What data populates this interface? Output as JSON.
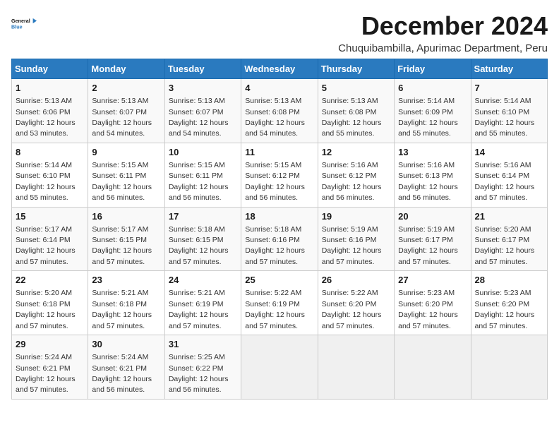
{
  "logo": {
    "line1": "General",
    "line2": "Blue"
  },
  "header": {
    "month_year": "December 2024",
    "location": "Chuquibambilla, Apurimac Department, Peru"
  },
  "weekdays": [
    "Sunday",
    "Monday",
    "Tuesday",
    "Wednesday",
    "Thursday",
    "Friday",
    "Saturday"
  ],
  "weeks": [
    [
      {
        "day": "1",
        "sunrise": "5:13 AM",
        "sunset": "6:06 PM",
        "daylight": "12 hours and 53 minutes."
      },
      {
        "day": "2",
        "sunrise": "5:13 AM",
        "sunset": "6:07 PM",
        "daylight": "12 hours and 54 minutes."
      },
      {
        "day": "3",
        "sunrise": "5:13 AM",
        "sunset": "6:07 PM",
        "daylight": "12 hours and 54 minutes."
      },
      {
        "day": "4",
        "sunrise": "5:13 AM",
        "sunset": "6:08 PM",
        "daylight": "12 hours and 54 minutes."
      },
      {
        "day": "5",
        "sunrise": "5:13 AM",
        "sunset": "6:08 PM",
        "daylight": "12 hours and 55 minutes."
      },
      {
        "day": "6",
        "sunrise": "5:14 AM",
        "sunset": "6:09 PM",
        "daylight": "12 hours and 55 minutes."
      },
      {
        "day": "7",
        "sunrise": "5:14 AM",
        "sunset": "6:10 PM",
        "daylight": "12 hours and 55 minutes."
      }
    ],
    [
      {
        "day": "8",
        "sunrise": "5:14 AM",
        "sunset": "6:10 PM",
        "daylight": "12 hours and 55 minutes."
      },
      {
        "day": "9",
        "sunrise": "5:15 AM",
        "sunset": "6:11 PM",
        "daylight": "12 hours and 56 minutes."
      },
      {
        "day": "10",
        "sunrise": "5:15 AM",
        "sunset": "6:11 PM",
        "daylight": "12 hours and 56 minutes."
      },
      {
        "day": "11",
        "sunrise": "5:15 AM",
        "sunset": "6:12 PM",
        "daylight": "12 hours and 56 minutes."
      },
      {
        "day": "12",
        "sunrise": "5:16 AM",
        "sunset": "6:12 PM",
        "daylight": "12 hours and 56 minutes."
      },
      {
        "day": "13",
        "sunrise": "5:16 AM",
        "sunset": "6:13 PM",
        "daylight": "12 hours and 56 minutes."
      },
      {
        "day": "14",
        "sunrise": "5:16 AM",
        "sunset": "6:14 PM",
        "daylight": "12 hours and 57 minutes."
      }
    ],
    [
      {
        "day": "15",
        "sunrise": "5:17 AM",
        "sunset": "6:14 PM",
        "daylight": "12 hours and 57 minutes."
      },
      {
        "day": "16",
        "sunrise": "5:17 AM",
        "sunset": "6:15 PM",
        "daylight": "12 hours and 57 minutes."
      },
      {
        "day": "17",
        "sunrise": "5:18 AM",
        "sunset": "6:15 PM",
        "daylight": "12 hours and 57 minutes."
      },
      {
        "day": "18",
        "sunrise": "5:18 AM",
        "sunset": "6:16 PM",
        "daylight": "12 hours and 57 minutes."
      },
      {
        "day": "19",
        "sunrise": "5:19 AM",
        "sunset": "6:16 PM",
        "daylight": "12 hours and 57 minutes."
      },
      {
        "day": "20",
        "sunrise": "5:19 AM",
        "sunset": "6:17 PM",
        "daylight": "12 hours and 57 minutes."
      },
      {
        "day": "21",
        "sunrise": "5:20 AM",
        "sunset": "6:17 PM",
        "daylight": "12 hours and 57 minutes."
      }
    ],
    [
      {
        "day": "22",
        "sunrise": "5:20 AM",
        "sunset": "6:18 PM",
        "daylight": "12 hours and 57 minutes."
      },
      {
        "day": "23",
        "sunrise": "5:21 AM",
        "sunset": "6:18 PM",
        "daylight": "12 hours and 57 minutes."
      },
      {
        "day": "24",
        "sunrise": "5:21 AM",
        "sunset": "6:19 PM",
        "daylight": "12 hours and 57 minutes."
      },
      {
        "day": "25",
        "sunrise": "5:22 AM",
        "sunset": "6:19 PM",
        "daylight": "12 hours and 57 minutes."
      },
      {
        "day": "26",
        "sunrise": "5:22 AM",
        "sunset": "6:20 PM",
        "daylight": "12 hours and 57 minutes."
      },
      {
        "day": "27",
        "sunrise": "5:23 AM",
        "sunset": "6:20 PM",
        "daylight": "12 hours and 57 minutes."
      },
      {
        "day": "28",
        "sunrise": "5:23 AM",
        "sunset": "6:20 PM",
        "daylight": "12 hours and 57 minutes."
      }
    ],
    [
      {
        "day": "29",
        "sunrise": "5:24 AM",
        "sunset": "6:21 PM",
        "daylight": "12 hours and 57 minutes."
      },
      {
        "day": "30",
        "sunrise": "5:24 AM",
        "sunset": "6:21 PM",
        "daylight": "12 hours and 56 minutes."
      },
      {
        "day": "31",
        "sunrise": "5:25 AM",
        "sunset": "6:22 PM",
        "daylight": "12 hours and 56 minutes."
      },
      null,
      null,
      null,
      null
    ]
  ]
}
